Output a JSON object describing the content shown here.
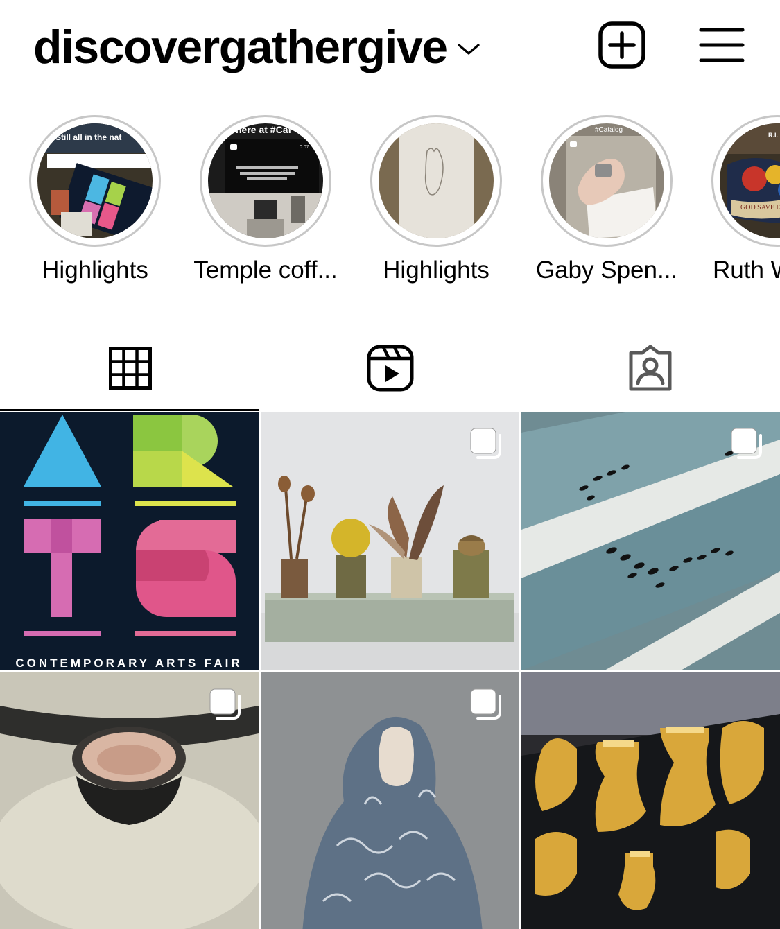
{
  "profile": {
    "username": "discovergathergive"
  },
  "highlights": [
    {
      "label": "Highlights",
      "thumb_text": "Still all in the nat"
    },
    {
      "label": "Temple coff...",
      "thumb_text": "here at #Caf",
      "thumb_subtext": "Mixing our Seasonal Blend today - 5 single origin speciality beans. Simply beautiful :)",
      "thumb_time": "0:07"
    },
    {
      "label": "Highlights"
    },
    {
      "label": "Gaby Spen...",
      "thumb_text": "#Catalog"
    },
    {
      "label": "Ruth W",
      "thumb_text": "GOD SAVE EI",
      "thumb_corner": "R.I."
    }
  ],
  "tabs": [
    {
      "name": "grid",
      "icon": "grid-icon",
      "active": true
    },
    {
      "name": "reels",
      "icon": "reels-icon",
      "active": false
    },
    {
      "name": "tagged",
      "icon": "tagged-icon",
      "active": false
    }
  ],
  "posts": [
    {
      "subject": "ARTS poster",
      "caption": "CONTEMPORARY ARTS FAIR",
      "multi": false
    },
    {
      "subject": "seed pods and feathers on wooden stand",
      "multi": true
    },
    {
      "subject": "fish pattern on blue ceramic",
      "multi": true
    },
    {
      "subject": "dark wooden bowl",
      "multi": true
    },
    {
      "subject": "figure with blue patterned scarf",
      "multi": true
    },
    {
      "subject": "gold ceramic pieces",
      "multi": false
    }
  ],
  "colors": {
    "ring": "#c7c7c7",
    "divider": "#dbdbdb",
    "text": "#000000"
  }
}
